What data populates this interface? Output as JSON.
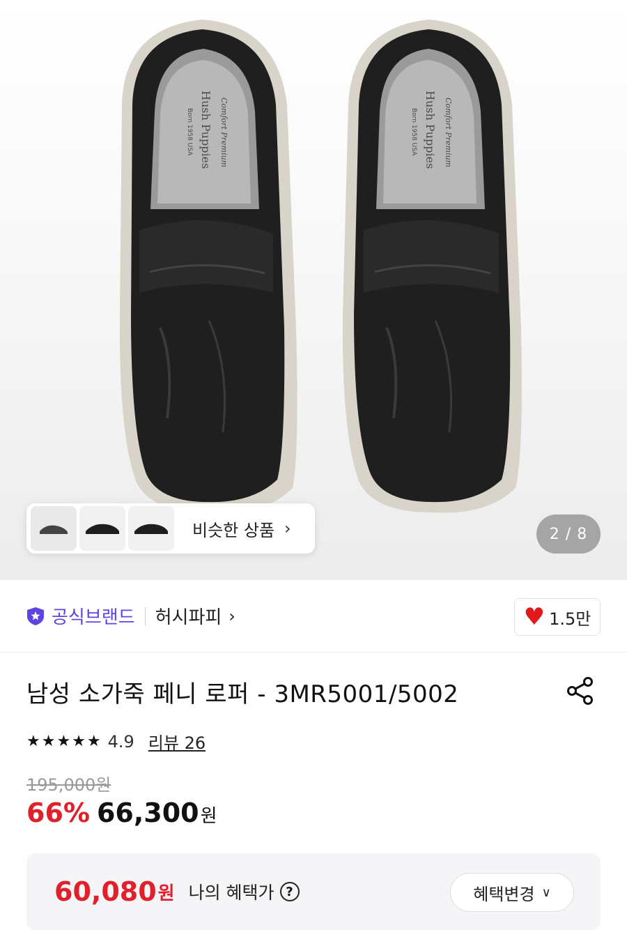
{
  "gallery": {
    "pager": "2 / 8",
    "similar_label": "비슷한 상품",
    "insole_brand": "Hush Puppies",
    "insole_tagline": "Comfort Premium",
    "insole_since": "Born 1958 USA"
  },
  "brand": {
    "official_label": "공식브랜드",
    "name": "허시파피",
    "likes": "1.5만"
  },
  "product": {
    "title": "남성 소가죽 페니 로퍼 - 3MR5001/5002",
    "stars": "★★★★★",
    "rating": "4.9",
    "review_label": "리뷰 26",
    "original_price": "195,000원",
    "discount": "66%",
    "sale_price": "66,300",
    "currency": "원"
  },
  "benefit": {
    "price": "60,080",
    "currency": "원",
    "label": "나의 혜택가",
    "help": "?",
    "change_label": "혜택변경"
  },
  "colors": {
    "accent_red": "#e0202a",
    "brand_purple": "#5f45e0"
  }
}
